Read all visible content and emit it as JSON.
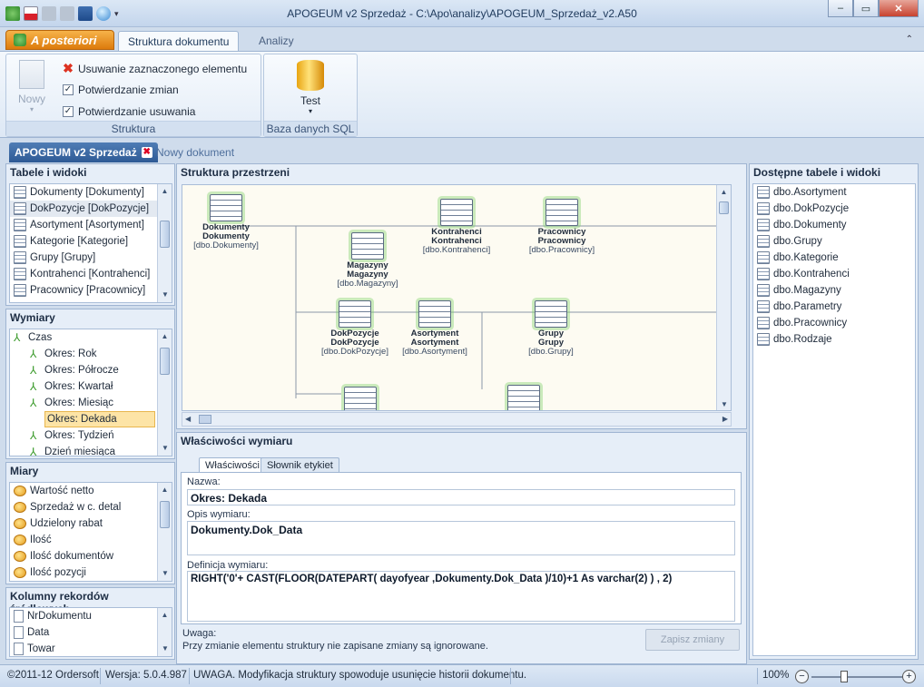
{
  "window": {
    "title": "APOGEUM v2 Sprzedaż - C:\\Apo\\analizy\\APOGEUM_Sprzedaż_v2.A50",
    "minimize": "‒",
    "maximize": "▭",
    "close": "✕"
  },
  "ribbon": {
    "app_button": "A posteriori",
    "tabs": [
      {
        "label": "Struktura dokumentu"
      },
      {
        "label": "Analizy"
      }
    ],
    "collapse": "⌃",
    "groups": {
      "struktura": {
        "label": "Struktura",
        "new_label": "Nowy",
        "remove_label": "Usuwanie zaznaczonego elementu",
        "confirm_changes_label": "Potwierdzanie zmian",
        "confirm_delete_label": "Potwierdzanie usuwania"
      },
      "baza": {
        "label": "Baza danych SQL",
        "test_label": "Test"
      }
    }
  },
  "doc_tabs": {
    "active": "APOGEUM v2 Sprzedaż",
    "new": "Nowy dokument"
  },
  "tables": {
    "title": "Tabele i widoki",
    "items": [
      {
        "label": "Dokumenty [Dokumenty]"
      },
      {
        "label": "DokPozycje [DokPozycje]"
      },
      {
        "label": "Asortyment [Asortyment]"
      },
      {
        "label": "Kategorie [Kategorie]"
      },
      {
        "label": "Grupy [Grupy]"
      },
      {
        "label": "Kontrahenci [Kontrahenci]"
      },
      {
        "label": "Pracownicy [Pracownicy]"
      }
    ]
  },
  "dimensions": {
    "title": "Wymiary",
    "items": [
      {
        "label": "Czas"
      },
      {
        "label": "Okres: Rok"
      },
      {
        "label": "Okres: Półrocze"
      },
      {
        "label": "Okres: Kwartał"
      },
      {
        "label": "Okres: Miesiąc"
      },
      {
        "label": "Okres: Dekada"
      },
      {
        "label": "Okres: Tydzień"
      },
      {
        "label": "Dzień miesiąca"
      }
    ]
  },
  "measures": {
    "title": "Miary",
    "items": [
      {
        "label": "Wartość netto"
      },
      {
        "label": "Sprzedaż w c. detal"
      },
      {
        "label": "Udzielony rabat"
      },
      {
        "label": "Ilość"
      },
      {
        "label": "Ilość dokumentów"
      },
      {
        "label": "Ilość pozycji"
      }
    ]
  },
  "columns": {
    "title": "Kolumny rekordów źródłowych",
    "items": [
      {
        "label": "NrDokumentu"
      },
      {
        "label": "Data"
      },
      {
        "label": "Towar"
      }
    ]
  },
  "structure": {
    "title": "Struktura przestrzeni",
    "nodes": [
      {
        "name": "Dokumenty",
        "alias": "Dokumenty",
        "table": "[dbo.Dokumenty]"
      },
      {
        "name": "Magazyny",
        "alias": "Magazyny",
        "table": "[dbo.Magazyny]"
      },
      {
        "name": "Kontrahenci",
        "alias": "Kontrahenci",
        "table": "[dbo.Kontrahenci]"
      },
      {
        "name": "Pracownicy",
        "alias": "Pracownicy",
        "table": "[dbo.Pracownicy]"
      },
      {
        "name": "DokPozycje",
        "alias": "DokPozycje",
        "table": "[dbo.DokPozycje]"
      },
      {
        "name": "Asortyment",
        "alias": "Asortyment",
        "table": "[dbo.Asortyment]"
      },
      {
        "name": "Grupy",
        "alias": "Grupy",
        "table": "[dbo.Grupy]"
      }
    ]
  },
  "available": {
    "title": "Dostępne tabele i widoki",
    "items": [
      {
        "label": "dbo.Asortyment"
      },
      {
        "label": "dbo.DokPozycje"
      },
      {
        "label": "dbo.Dokumenty"
      },
      {
        "label": "dbo.Grupy"
      },
      {
        "label": "dbo.Kategorie"
      },
      {
        "label": "dbo.Kontrahenci"
      },
      {
        "label": "dbo.Magazyny"
      },
      {
        "label": "dbo.Parametry"
      },
      {
        "label": "dbo.Pracownicy"
      },
      {
        "label": "dbo.Rodzaje"
      }
    ]
  },
  "props": {
    "title": "Właściwości wymiaru",
    "tabs": [
      "Właściwości",
      "Słownik etykiet"
    ],
    "name_label": "Nazwa:",
    "name_value": "Okres: Dekada",
    "desc_label": "Opis wymiaru:",
    "desc_value": "Dokumenty.Dok_Data",
    "def_label": "Definicja wymiaru:",
    "def_value": "RIGHT('0'+ CAST(FLOOR(DATEPART( dayofyear ,Dokumenty.Dok_Data )/10)+1 As varchar(2) ) , 2)",
    "note_label": "Uwaga:",
    "note_text": "Przy zmianie elementu struktury nie zapisane zmiany są ignorowane.",
    "save_button": "Zapisz zmiany"
  },
  "status": {
    "copyright": "©2011-12 Ordersoft",
    "version": "Wersja: 5.0.4.987",
    "warning": "UWAGA. Modyfikacja struktury spowoduje usunięcie historii dokumentu.",
    "zoom": "100%"
  }
}
